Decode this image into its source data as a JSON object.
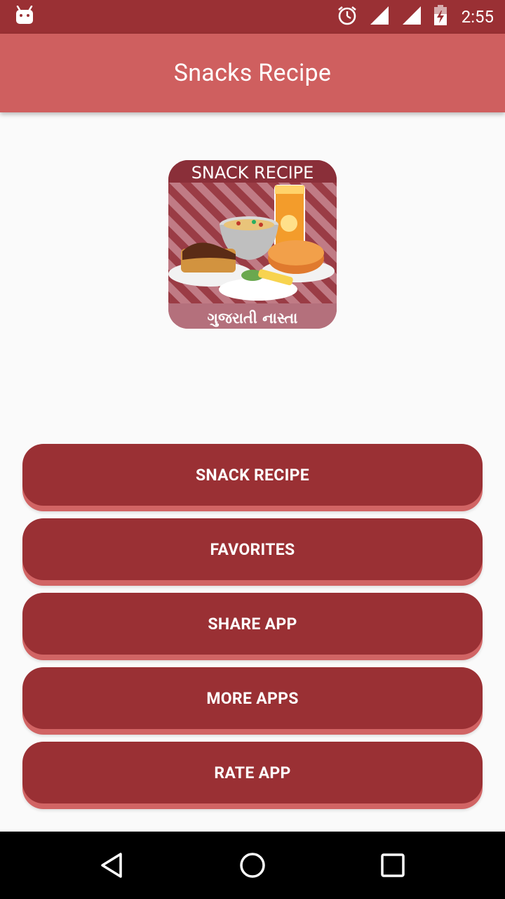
{
  "status_bar": {
    "time": "2:55",
    "icons": [
      "android-icon",
      "alarm-icon",
      "signal-icon",
      "wifi-icon",
      "battery-charging-icon"
    ]
  },
  "app_bar": {
    "title": "Snacks Recipe"
  },
  "logo": {
    "top_text": "SNACK RECIPE",
    "bottom_text": "ગુજરાતી નાસ્તા"
  },
  "menu": {
    "buttons": [
      {
        "label": "SNACK RECIPE"
      },
      {
        "label": "FAVORITES"
      },
      {
        "label": "SHARE APP"
      },
      {
        "label": "MORE APPS"
      },
      {
        "label": "RATE APP"
      }
    ]
  },
  "nav_bar": {
    "icons": [
      "back-icon",
      "home-icon",
      "recents-icon"
    ]
  },
  "colors": {
    "primary_dark": "#9a3034",
    "primary": "#cf5f5f",
    "button_shadow": "#d16464",
    "background": "#fafafa"
  }
}
